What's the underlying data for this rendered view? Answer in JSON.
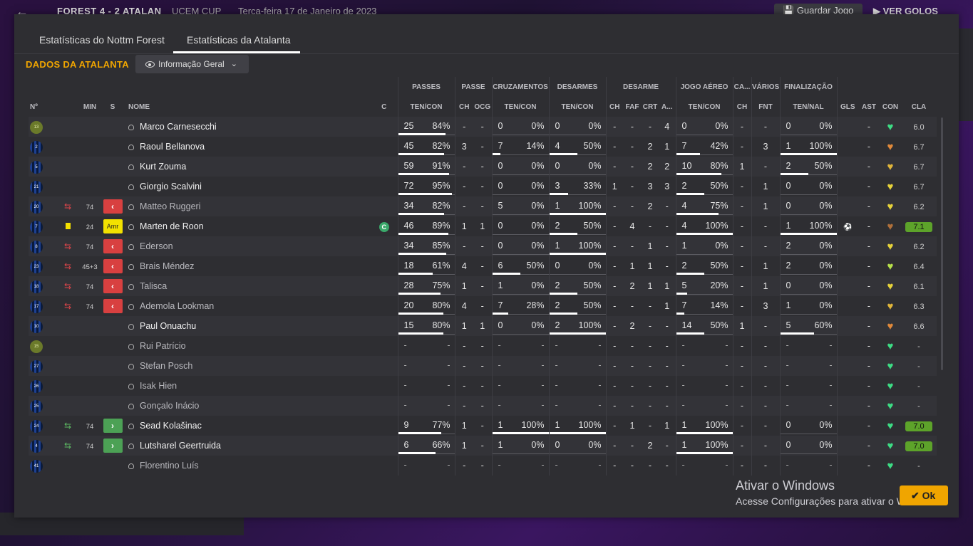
{
  "topbar": {
    "match": "FOREST  4 - 2  ATALAN",
    "competition": "UCEM CUP",
    "date": "Terça-feira 17 de Janeiro de 2023",
    "save_label": "Guardar Jogo",
    "goals_label": "VER GOLOS"
  },
  "tabs": [
    {
      "label": "Estatísticas do Nottm Forest"
    },
    {
      "label": "Estatísticas da Atalanta"
    }
  ],
  "section": {
    "title": "DADOS DA ATALANTA",
    "view_label": "Informação Geral"
  },
  "headers": {
    "groups": [
      "PASSES",
      "PASSE",
      "CRUZAMENTOS",
      "DESARMES",
      "DESARME",
      "JOGO AÉREO",
      "CA...",
      "VÁRIOS",
      "FINALIZAÇÃO"
    ],
    "cols": {
      "no": "Nº",
      "min": "MIN",
      "s": "S",
      "name": "NOME",
      "c": "C",
      "passes": "TEN/CON",
      "ch": "CH",
      "ocg": "OCG",
      "cruz": "TEN/CON",
      "des": "TEN/CON",
      "dch": "CH",
      "faf": "FAF",
      "crt": "CRT",
      "a": "A...",
      "aereo": "TEN/CON",
      "cach": "CH",
      "fnt": "FNT",
      "fin": "TEN/NAL",
      "gls": "GLS",
      "ast": "AST",
      "con": "CON",
      "cla": "CLA"
    }
  },
  "players": [
    {
      "no": "13",
      "gk": true,
      "sub": "",
      "min": "",
      "pos": "",
      "name": "Marco Carnesecchi",
      "cap": false,
      "dim": false,
      "p": [
        "25",
        "84%",
        84
      ],
      "ch": "-",
      "ocg": "-",
      "cr": [
        "0",
        "0%",
        0
      ],
      "de": [
        "0",
        "0%",
        0
      ],
      "dch": "-",
      "faf": "-",
      "crt": "-",
      "a": "4",
      "ae": [
        "0",
        "0%",
        0
      ],
      "cach": "-",
      "fnt": "-",
      "fi": [
        "0",
        "0%",
        0
      ],
      "gls": "",
      "ast": "-",
      "con": "green",
      "cla": "6.0",
      "hi": false
    },
    {
      "no": "2",
      "gk": false,
      "sub": "",
      "min": "",
      "pos": "",
      "name": "Raoul Bellanova",
      "cap": false,
      "dim": false,
      "p": [
        "45",
        "82%",
        82
      ],
      "ch": "3",
      "ocg": "-",
      "cr": [
        "7",
        "14%",
        14
      ],
      "de": [
        "4",
        "50%",
        50
      ],
      "dch": "-",
      "faf": "-",
      "crt": "2",
      "a": "1",
      "ae": [
        "7",
        "42%",
        42
      ],
      "cach": "-",
      "fnt": "3",
      "fi": [
        "1",
        "100%",
        100
      ],
      "gls": "",
      "ast": "-",
      "con": "orange",
      "cla": "6.7",
      "hi": false
    },
    {
      "no": "5",
      "gk": false,
      "sub": "",
      "min": "",
      "pos": "",
      "name": "Kurt Zouma",
      "cap": false,
      "dim": false,
      "p": [
        "59",
        "91%",
        91
      ],
      "ch": "-",
      "ocg": "-",
      "cr": [
        "0",
        "0%",
        0
      ],
      "de": [
        "0",
        "0%",
        0
      ],
      "dch": "-",
      "faf": "-",
      "crt": "2",
      "a": "2",
      "ae": [
        "10",
        "80%",
        80
      ],
      "cach": "1",
      "fnt": "-",
      "fi": [
        "2",
        "50%",
        50
      ],
      "gls": "",
      "ast": "-",
      "con": "gold",
      "cla": "6.7",
      "hi": false
    },
    {
      "no": "21",
      "gk": false,
      "sub": "",
      "min": "",
      "pos": "",
      "name": "Giorgio Scalvini",
      "cap": false,
      "dim": false,
      "p": [
        "72",
        "95%",
        95
      ],
      "ch": "-",
      "ocg": "-",
      "cr": [
        "0",
        "0%",
        0
      ],
      "de": [
        "3",
        "33%",
        33
      ],
      "dch": "1",
      "faf": "-",
      "crt": "3",
      "a": "3",
      "ae": [
        "2",
        "50%",
        50
      ],
      "cach": "-",
      "fnt": "1",
      "fi": [
        "0",
        "0%",
        0
      ],
      "gls": "",
      "ast": "-",
      "con": "yellow",
      "cla": "6.7",
      "hi": false
    },
    {
      "no": "20",
      "gk": false,
      "sub": "out",
      "min": "74",
      "pos": "out",
      "name": "Matteo Ruggeri",
      "cap": false,
      "dim": true,
      "p": [
        "34",
        "82%",
        82
      ],
      "ch": "-",
      "ocg": "-",
      "cr": [
        "5",
        "0%",
        0
      ],
      "de": [
        "1",
        "100%",
        100
      ],
      "dch": "-",
      "faf": "-",
      "crt": "2",
      "a": "-",
      "ae": [
        "4",
        "75%",
        75
      ],
      "cach": "-",
      "fnt": "1",
      "fi": [
        "0",
        "0%",
        0
      ],
      "gls": "",
      "ast": "-",
      "con": "yellow",
      "cla": "6.2",
      "hi": false
    },
    {
      "no": "7",
      "gk": false,
      "sub": "yc",
      "min": "24",
      "pos": "amr",
      "name": "Marten de Roon",
      "cap": true,
      "dim": false,
      "p": [
        "46",
        "89%",
        89
      ],
      "ch": "1",
      "ocg": "1",
      "cr": [
        "0",
        "0%",
        0
      ],
      "de": [
        "2",
        "50%",
        50
      ],
      "dch": "-",
      "faf": "4",
      "crt": "-",
      "a": "-",
      "ae": [
        "4",
        "100%",
        100
      ],
      "cach": "-",
      "fnt": "-",
      "fi": [
        "1",
        "100%",
        100
      ],
      "gls": "ball",
      "ast": "-",
      "con": "brown",
      "cla": "7.1",
      "hi": true
    },
    {
      "no": "8",
      "gk": false,
      "sub": "out",
      "min": "74",
      "pos": "out",
      "name": "Ederson",
      "cap": false,
      "dim": true,
      "p": [
        "34",
        "85%",
        85
      ],
      "ch": "-",
      "ocg": "-",
      "cr": [
        "0",
        "0%",
        0
      ],
      "de": [
        "1",
        "100%",
        100
      ],
      "dch": "-",
      "faf": "-",
      "crt": "1",
      "a": "-",
      "ae": [
        "1",
        "0%",
        0
      ],
      "cach": "-",
      "fnt": "-",
      "fi": [
        "2",
        "0%",
        0
      ],
      "gls": "",
      "ast": "-",
      "con": "yellow",
      "cla": "6.2",
      "hi": false
    },
    {
      "no": "23",
      "gk": false,
      "sub": "out",
      "min": "45+3",
      "pos": "out",
      "name": "Brais Méndez",
      "cap": false,
      "dim": true,
      "p": [
        "18",
        "61%",
        61
      ],
      "ch": "4",
      "ocg": "-",
      "cr": [
        "6",
        "50%",
        50
      ],
      "de": [
        "0",
        "0%",
        0
      ],
      "dch": "-",
      "faf": "1",
      "crt": "1",
      "a": "-",
      "ae": [
        "2",
        "50%",
        50
      ],
      "cach": "-",
      "fnt": "1",
      "fi": [
        "2",
        "0%",
        0
      ],
      "gls": "",
      "ast": "-",
      "con": "lime",
      "cla": "6.4",
      "hi": false
    },
    {
      "no": "18",
      "gk": false,
      "sub": "out",
      "min": "74",
      "pos": "out",
      "name": "Talisca",
      "cap": false,
      "dim": true,
      "p": [
        "28",
        "75%",
        75
      ],
      "ch": "1",
      "ocg": "-",
      "cr": [
        "1",
        "0%",
        0
      ],
      "de": [
        "2",
        "50%",
        50
      ],
      "dch": "-",
      "faf": "2",
      "crt": "1",
      "a": "1",
      "ae": [
        "5",
        "20%",
        20
      ],
      "cach": "-",
      "fnt": "1",
      "fi": [
        "0",
        "0%",
        0
      ],
      "gls": "",
      "ast": "-",
      "con": "yellow",
      "cla": "6.1",
      "hi": false
    },
    {
      "no": "17",
      "gk": false,
      "sub": "out",
      "min": "74",
      "pos": "out",
      "name": "Ademola Lookman",
      "cap": false,
      "dim": true,
      "p": [
        "20",
        "80%",
        80
      ],
      "ch": "4",
      "ocg": "-",
      "cr": [
        "7",
        "28%",
        28
      ],
      "de": [
        "2",
        "50%",
        50
      ],
      "dch": "-",
      "faf": "-",
      "crt": "-",
      "a": "1",
      "ae": [
        "7",
        "14%",
        14
      ],
      "cach": "-",
      "fnt": "3",
      "fi": [
        "1",
        "0%",
        0
      ],
      "gls": "",
      "ast": "-",
      "con": "gold",
      "cla": "6.3",
      "hi": false
    },
    {
      "no": "10",
      "gk": false,
      "sub": "",
      "min": "",
      "pos": "",
      "name": "Paul Onuachu",
      "cap": false,
      "dim": false,
      "p": [
        "15",
        "80%",
        80
      ],
      "ch": "1",
      "ocg": "1",
      "cr": [
        "0",
        "0%",
        0
      ],
      "de": [
        "2",
        "100%",
        100
      ],
      "dch": "-",
      "faf": "2",
      "crt": "-",
      "a": "-",
      "ae": [
        "14",
        "50%",
        50
      ],
      "cach": "1",
      "fnt": "-",
      "fi": [
        "5",
        "60%",
        60
      ],
      "gls": "",
      "ast": "-",
      "con": "orange",
      "cla": "6.6",
      "hi": false
    },
    {
      "no": "15",
      "gk": true,
      "sub": "",
      "min": "",
      "pos": "",
      "name": "Rui Patrício",
      "cap": false,
      "dim": true,
      "p": null,
      "ch": "-",
      "ocg": "-",
      "cr": null,
      "de": null,
      "dch": "-",
      "faf": "-",
      "crt": "-",
      "a": "-",
      "ae": null,
      "cach": "-",
      "fnt": "-",
      "fi": null,
      "gls": "",
      "ast": "-",
      "con": "green",
      "cla": "-",
      "hi": false
    },
    {
      "no": "27",
      "gk": false,
      "sub": "",
      "min": "",
      "pos": "",
      "name": "Stefan Posch",
      "cap": false,
      "dim": true,
      "p": null,
      "ch": "-",
      "ocg": "-",
      "cr": null,
      "de": null,
      "dch": "-",
      "faf": "-",
      "crt": "-",
      "a": "-",
      "ae": null,
      "cach": "-",
      "fnt": "-",
      "fi": null,
      "gls": "",
      "ast": "-",
      "con": "green",
      "cla": "-",
      "hi": false
    },
    {
      "no": "26",
      "gk": false,
      "sub": "",
      "min": "",
      "pos": "",
      "name": "Isak Hien",
      "cap": false,
      "dim": true,
      "p": null,
      "ch": "-",
      "ocg": "-",
      "cr": null,
      "de": null,
      "dch": "-",
      "faf": "-",
      "crt": "-",
      "a": "-",
      "ae": null,
      "cach": "-",
      "fnt": "-",
      "fi": null,
      "gls": "",
      "ast": "-",
      "con": "green",
      "cla": "-",
      "hi": false
    },
    {
      "no": "25",
      "gk": false,
      "sub": "",
      "min": "",
      "pos": "",
      "name": "Gonçalo Inácio",
      "cap": false,
      "dim": true,
      "p": null,
      "ch": "-",
      "ocg": "-",
      "cr": null,
      "de": null,
      "dch": "-",
      "faf": "-",
      "crt": "-",
      "a": "-",
      "ae": null,
      "cach": "-",
      "fnt": "-",
      "fi": null,
      "gls": "",
      "ast": "-",
      "con": "green",
      "cla": "-",
      "hi": false
    },
    {
      "no": "24",
      "gk": false,
      "sub": "in",
      "min": "74",
      "pos": "in",
      "name": "Sead Kolašinac",
      "cap": false,
      "dim": false,
      "p": [
        "9",
        "77%",
        77
      ],
      "ch": "1",
      "ocg": "-",
      "cr": [
        "1",
        "100%",
        100
      ],
      "de": [
        "1",
        "100%",
        100
      ],
      "dch": "-",
      "faf": "1",
      "crt": "-",
      "a": "1",
      "ae": [
        "1",
        "100%",
        100
      ],
      "cach": "-",
      "fnt": "-",
      "fi": [
        "0",
        "0%",
        0
      ],
      "gls": "",
      "ast": "-",
      "con": "green",
      "cla": "7.0",
      "hi": true
    },
    {
      "no": "4",
      "gk": false,
      "sub": "in",
      "min": "74",
      "pos": "in",
      "name": "Lutsharel Geertruida",
      "cap": false,
      "dim": false,
      "p": [
        "6",
        "66%",
        66
      ],
      "ch": "1",
      "ocg": "-",
      "cr": [
        "1",
        "0%",
        0
      ],
      "de": [
        "0",
        "0%",
        0
      ],
      "dch": "-",
      "faf": "-",
      "crt": "2",
      "a": "-",
      "ae": [
        "1",
        "100%",
        100
      ],
      "cach": "-",
      "fnt": "-",
      "fi": [
        "0",
        "0%",
        0
      ],
      "gls": "",
      "ast": "-",
      "con": "green",
      "cla": "7.0",
      "hi": true
    },
    {
      "no": "41",
      "gk": false,
      "sub": "",
      "min": "",
      "pos": "",
      "name": "Florentino Luís",
      "cap": false,
      "dim": true,
      "p": null,
      "ch": "-",
      "ocg": "-",
      "cr": null,
      "de": null,
      "dch": "-",
      "faf": "-",
      "crt": "-",
      "a": "-",
      "ae": null,
      "cach": "-",
      "fnt": "-",
      "fi": null,
      "gls": "",
      "ast": "-",
      "con": "green",
      "cla": "-",
      "hi": false
    }
  ],
  "mood_colors": {
    "green": "#3ddc84",
    "orange": "#e0893a",
    "gold": "#e0b53a",
    "yellow": "#e6d23a",
    "lime": "#b7e04a",
    "brown": "#b0703a"
  },
  "ok_label": "Ok",
  "watermark": {
    "line1": "Ativar o Windows",
    "line2": "Acesse Configurações para ativar o Windows."
  }
}
